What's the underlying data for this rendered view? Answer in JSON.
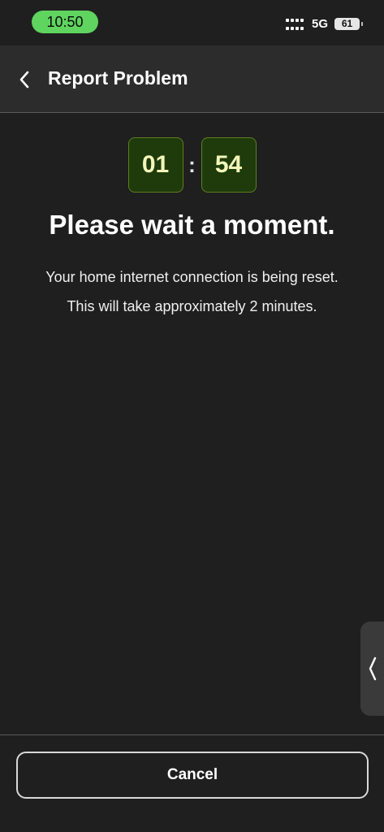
{
  "status_bar": {
    "time": "10:50",
    "network": "5G",
    "battery": "61",
    "accent_color": "#5fd45f"
  },
  "header": {
    "title": "Report Problem",
    "back_icon": "chevron-left-icon"
  },
  "timer": {
    "minutes": "01",
    "separator": ":",
    "seconds": "54",
    "box_color": "#1f3b0c"
  },
  "message": {
    "headline": "Please wait a moment.",
    "line1": "Your home internet connection is being reset.",
    "line2": "This will take approximately 2 minutes."
  },
  "side_handle": {
    "icon": "chevron-left-icon"
  },
  "footer": {
    "cancel_label": "Cancel"
  }
}
